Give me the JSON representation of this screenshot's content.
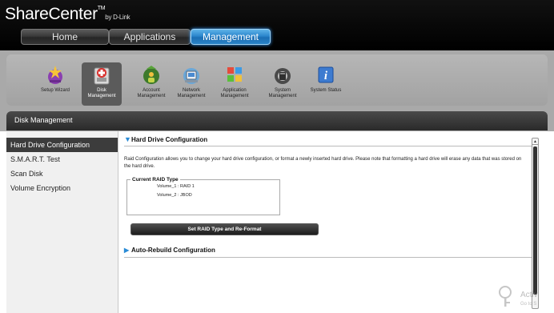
{
  "brand": {
    "name": "ShareCenter",
    "tm": "TM",
    "by": "by D-Link"
  },
  "tabs": [
    {
      "label": "Home"
    },
    {
      "label": "Applications"
    },
    {
      "label": "Management"
    }
  ],
  "icons": [
    {
      "label_1": "Setup Wizard",
      "label_2": ""
    },
    {
      "label_1": "Disk",
      "label_2": "Management"
    },
    {
      "label_1": "Account",
      "label_2": "Management"
    },
    {
      "label_1": "Network",
      "label_2": "Management"
    },
    {
      "label_1": "Application",
      "label_2": "Management"
    },
    {
      "label_1": "System",
      "label_2": "Management"
    },
    {
      "label_1": "System Status",
      "label_2": ""
    }
  ],
  "section_title": "Disk Management",
  "left_nav": [
    {
      "label": "Hard Drive Configuration"
    },
    {
      "label": "S.M.A.R.T. Test"
    },
    {
      "label": "Scan Disk"
    },
    {
      "label": "Volume Encryption"
    }
  ],
  "content": {
    "heading": "Hard Drive Configuration",
    "description": "Raid Configuration allows you to change your hard drive configuration, or format a newly inserted hard drive. Please note that formatting a hard drive will erase any data that was stored on the hard drive.",
    "raid_legend": "Current RAID Type",
    "volumes": [
      "Volume_1 : RAID 1",
      "Volume_2 : JBOD"
    ],
    "set_button": "Set RAID Type and Re-Format",
    "auto_rebuild_heading": "Auto-Rebuild Configuration"
  },
  "watermark": {
    "line1": "Activ",
    "line2": "Go to S"
  },
  "colors": {
    "accent": "#2a8bd6",
    "header_bg": "#000000",
    "active_tab": "#1b6fb5",
    "active_nav": "#3c3c3c"
  }
}
